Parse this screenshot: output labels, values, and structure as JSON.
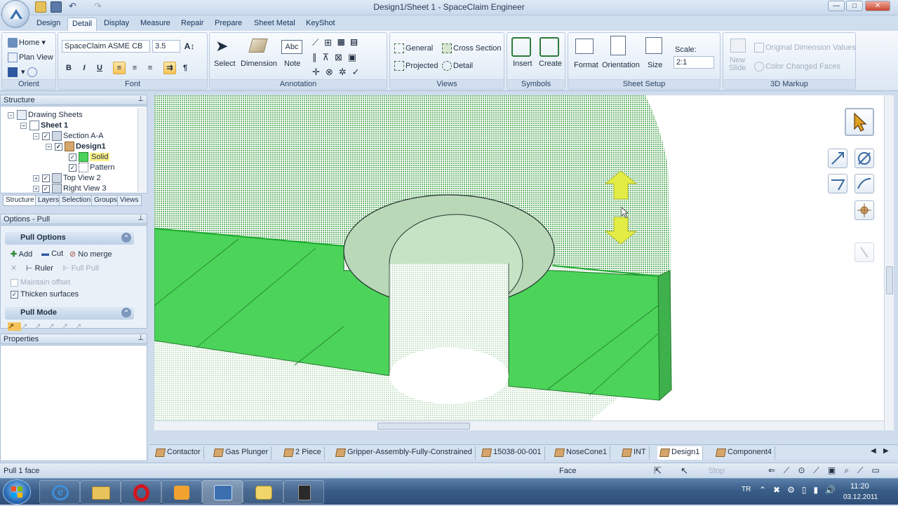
{
  "window": {
    "title": "Design1/Sheet 1 - SpaceClaim Engineer",
    "buttons": {
      "minimize": "—",
      "maximize": "□",
      "close": "✕"
    }
  },
  "tabs": [
    {
      "label": "Design",
      "active": false
    },
    {
      "label": "Detail",
      "active": true
    },
    {
      "label": "Display",
      "active": false
    },
    {
      "label": "Measure",
      "active": false
    },
    {
      "label": "Repair",
      "active": false
    },
    {
      "label": "Prepare",
      "active": false
    },
    {
      "label": "Sheet Metal",
      "active": false
    },
    {
      "label": "KeyShot",
      "active": false
    }
  ],
  "ribbon": {
    "orient": {
      "label": "Orient",
      "home": "Home",
      "plan_view": "Plan View"
    },
    "font": {
      "label": "Font",
      "family": "SpaceClaim ASME CB",
      "size": "3.5",
      "bold": "B",
      "italic": "I",
      "underline": "U"
    },
    "annotation": {
      "label": "Annotation",
      "select": "Select",
      "dimension": "Dimension",
      "note": "Note",
      "note_icon_text": "Abc"
    },
    "views": {
      "label": "Views",
      "general": "General",
      "cross_section": "Cross Section",
      "projected": "Projected",
      "detail": "Detail"
    },
    "symbols": {
      "label": "Symbols",
      "insert": "Insert",
      "create": "Create"
    },
    "sheet_setup": {
      "label": "Sheet Setup",
      "format": "Format",
      "orientation": "Orientation",
      "size": "Size",
      "scale_label": "Scale:",
      "scale_value": "2:1"
    },
    "markup": {
      "label": "3D Markup",
      "new_slide": "New\nSlide",
      "original_dimension_values": "Original Dimension Values",
      "color_changed_faces": "Color Changed Faces"
    }
  },
  "structure": {
    "title": "Structure",
    "tree": [
      {
        "label": "Drawing Sheets",
        "indent": 0
      },
      {
        "label": "Sheet 1",
        "indent": 1
      },
      {
        "label": "Section A-A",
        "indent": 2
      },
      {
        "label": "Design1",
        "indent": 3
      },
      {
        "label": "Solid",
        "indent": 4
      },
      {
        "label": "Pattern",
        "indent": 4
      },
      {
        "label": "Top View 2",
        "indent": 2
      },
      {
        "label": "Right View 3",
        "indent": 2
      }
    ],
    "tabs": [
      "Structure",
      "Layers",
      "Selection",
      "Groups",
      "Views"
    ]
  },
  "options": {
    "title": "Options - Pull",
    "pull_options": "Pull Options",
    "add": "Add",
    "cut": "Cut",
    "no_merge": "No merge",
    "ruler": "Ruler",
    "full_pull": "Full Pull",
    "maintain_offset": "Maintain offset",
    "thicken_surfaces": "Thicken surfaces",
    "pull_mode": "Pull Mode"
  },
  "properties": {
    "title": "Properties"
  },
  "doc_tabs": [
    "Contactor",
    "Gas Plunger",
    "2 Piece",
    "Gripper-Assembly-Fully-Constrained",
    "15038-00-001",
    "NoseCone1",
    "INT",
    "Design1",
    "Component4"
  ],
  "status": {
    "left": "Pull 1 face",
    "mode": "Face",
    "stop": "Stop"
  },
  "taskbar": {
    "lang": "TR",
    "time": "11:20",
    "date": "03.12.2011"
  },
  "colors": {
    "face_green": "#4cd45a",
    "ribbon_blue": "#dce7f3",
    "accent_yellow": "#e3ec44"
  }
}
